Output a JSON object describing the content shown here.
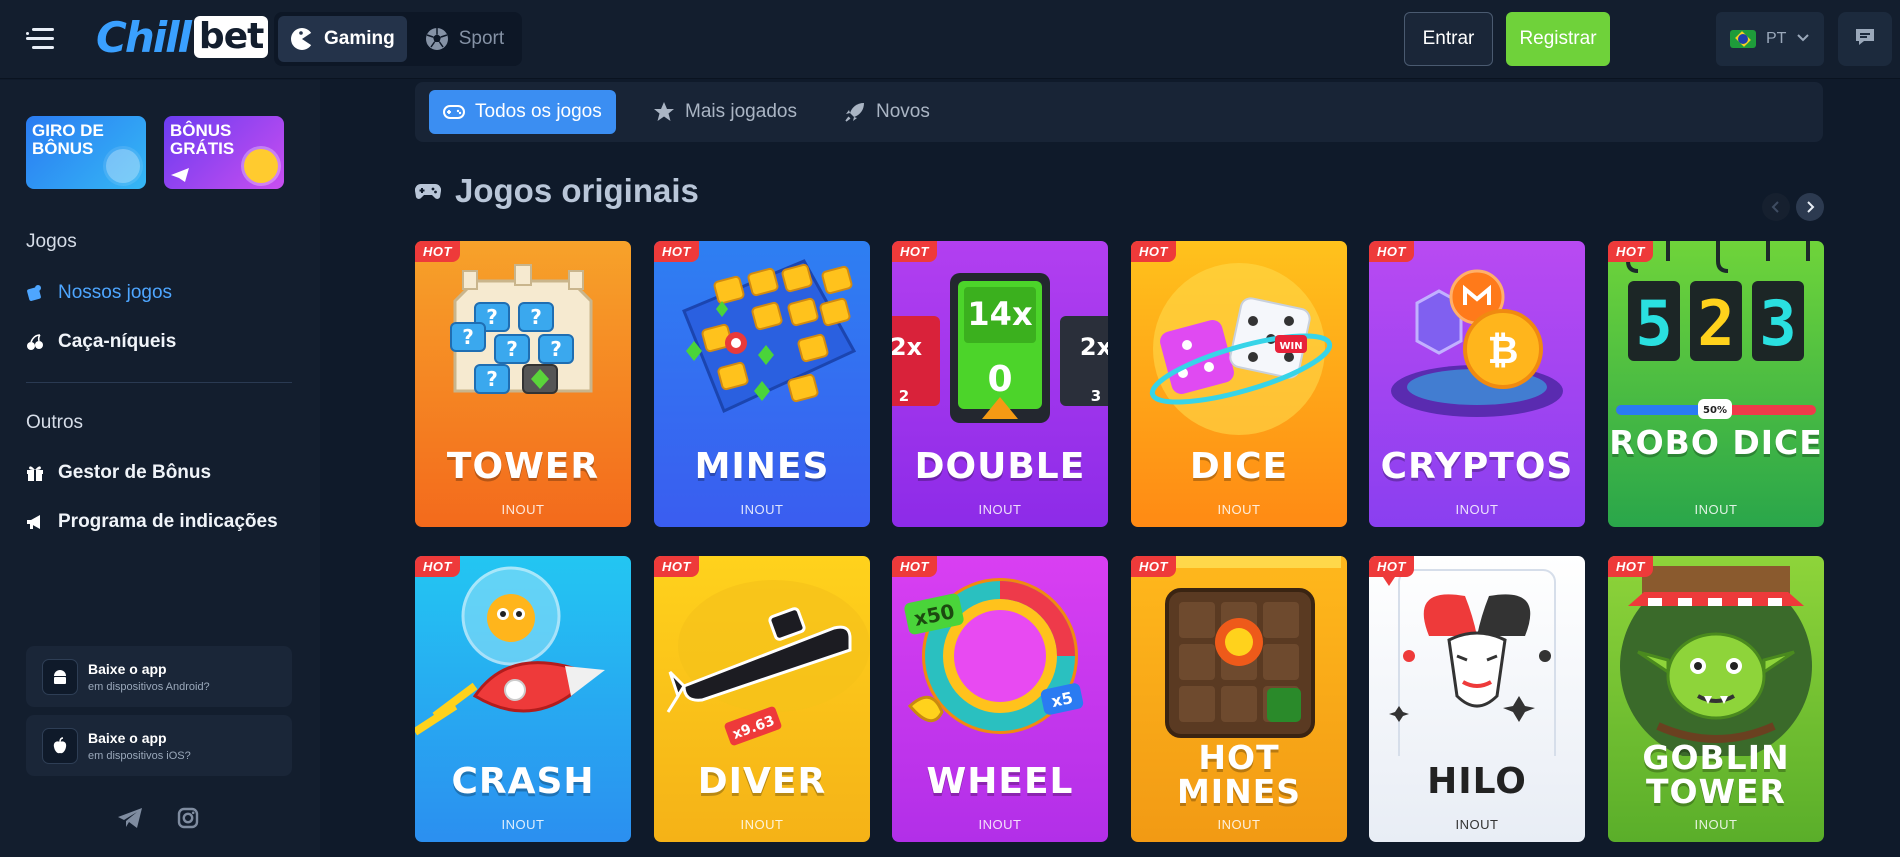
{
  "header": {
    "logo_main": "Chill",
    "logo_box": "bet",
    "modes": [
      {
        "label": "Gaming",
        "active": true
      },
      {
        "label": "Sport",
        "active": false
      }
    ],
    "login_label": "Entrar",
    "register_label": "Registrar",
    "language": "PT"
  },
  "sidebar": {
    "promos": [
      {
        "text": "GIRO DE BÔNUS"
      },
      {
        "text": "BÔNUS GRÁTIS"
      }
    ],
    "section_games": "Jogos",
    "games_items": [
      {
        "label": "Nossos jogos",
        "active": true
      },
      {
        "label": "Caça-níqueis",
        "active": false
      }
    ],
    "section_others": "Outros",
    "other_items": [
      {
        "label": "Gestor de Bônus"
      },
      {
        "label": "Programa de indicações"
      }
    ],
    "apps": [
      {
        "title": "Baixe o app",
        "subtitle": "em dispositivos Android?"
      },
      {
        "title": "Baixe o app",
        "subtitle": "em dispositivos iOS?"
      }
    ]
  },
  "tabs": [
    {
      "label": "Todos os jogos",
      "active": true
    },
    {
      "label": "Mais jogados",
      "active": false
    },
    {
      "label": "Novos",
      "active": false
    }
  ],
  "section_title": "Jogos originais",
  "games": [
    {
      "title": "TOWER",
      "badge": "HOT",
      "provider": "INOUT",
      "color1": "#f7a22a",
      "color2": "#f36a1c"
    },
    {
      "title": "MINES",
      "badge": "HOT",
      "provider": "INOUT",
      "color1": "#2e7ff2",
      "color2": "#3a5df0"
    },
    {
      "title": "DOUBLE",
      "badge": "HOT",
      "provider": "INOUT",
      "color1": "#b23ff0",
      "color2": "#8d2be8"
    },
    {
      "title": "DICE",
      "badge": "HOT",
      "provider": "INOUT",
      "color1": "#ffc21c",
      "color2": "#ff8a14"
    },
    {
      "title": "CRYPTOS",
      "badge": "HOT",
      "provider": "INOUT",
      "color1": "#b94af2",
      "color2": "#8a3ff0"
    },
    {
      "title": "ROBO DICE",
      "badge": "HOT",
      "provider": "INOUT",
      "color1": "#6fd43a",
      "color2": "#2aa64a"
    },
    {
      "title": "CRASH",
      "badge": "HOT",
      "provider": "INOUT",
      "color1": "#23c6f2",
      "color2": "#2b8ff0"
    },
    {
      "title": "DIVER",
      "badge": "HOT",
      "provider": "INOUT",
      "color1": "#ffd21c",
      "color2": "#f5b217"
    },
    {
      "title": "WHEEL",
      "badge": "HOT",
      "provider": "INOUT",
      "color1": "#d93ff2",
      "color2": "#b22fe8"
    },
    {
      "title": "HOT MINES",
      "badge": "HOT",
      "provider": "INOUT",
      "color1": "#ffb81c",
      "color2": "#f29a14"
    },
    {
      "title": "HILO",
      "badge": "HOT",
      "provider": "INOUT",
      "color1": "#ffffff",
      "color2": "#e8edf5"
    },
    {
      "title": "GOBLIN TOWER",
      "badge": "HOT",
      "provider": "INOUT",
      "color1": "#8ed43a",
      "color2": "#5aae2a"
    }
  ],
  "art_labels": {
    "double_value": "14x",
    "double_zero": "0",
    "double_side_left": "2x",
    "double_side_left_num": "2",
    "double_side_right": "2x",
    "double_side_right_num": "3",
    "robo_digits": "523",
    "robo_percent": "50%",
    "wheel_x50": "x50",
    "wheel_x5": "x5",
    "diver_mult": "x9.63",
    "dice_win": "WIN"
  }
}
